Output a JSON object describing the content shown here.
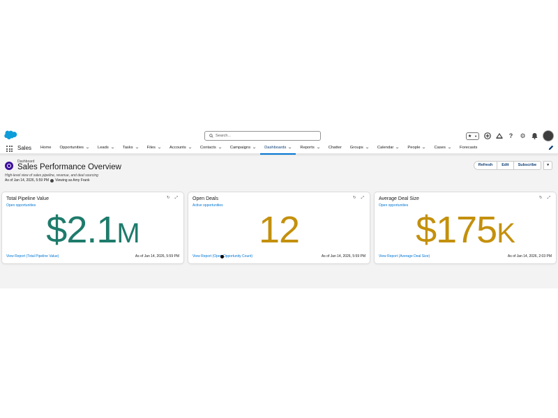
{
  "header": {
    "search_placeholder": "Search..."
  },
  "nav": {
    "app_name": "Sales",
    "items": [
      {
        "label": "Home",
        "chevron": false
      },
      {
        "label": "Opportunities",
        "chevron": true
      },
      {
        "label": "Leads",
        "chevron": true
      },
      {
        "label": "Tasks",
        "chevron": true
      },
      {
        "label": "Files",
        "chevron": true
      },
      {
        "label": "Accounts",
        "chevron": true
      },
      {
        "label": "Contacts",
        "chevron": true
      },
      {
        "label": "Campaigns",
        "chevron": true
      },
      {
        "label": "Dashboards",
        "chevron": true,
        "active": true
      },
      {
        "label": "Reports",
        "chevron": true
      },
      {
        "label": "Chatter",
        "chevron": false
      },
      {
        "label": "Groups",
        "chevron": true
      },
      {
        "label": "Calendar",
        "chevron": true
      },
      {
        "label": "People",
        "chevron": true
      },
      {
        "label": "Cases",
        "chevron": true
      },
      {
        "label": "Forecasts",
        "chevron": false
      }
    ]
  },
  "page": {
    "label": "Dashboard",
    "title": "Sales Performance Overview",
    "description": "High-level view of sales pipeline, revenue, and deal sourcing",
    "as_of": "As of Jan 14, 2026, 5:59 PM",
    "viewing_as": "Viewing as Amy Frank",
    "buttons": {
      "refresh": "Refresh",
      "edit": "Edit",
      "subscribe": "Subscribe",
      "more": "▾"
    }
  },
  "cards": [
    {
      "title": "Total Pipeline Value",
      "subtitle": "Open opportunities",
      "value": "$2.1",
      "suffix": "M",
      "color": "#1e7b6b",
      "link": "View Report (Total Pipeline Value)",
      "timestamp": "As of Jan 14, 2026, 5:59 PM"
    },
    {
      "title": "Open Deals",
      "subtitle": "Active opportunities",
      "value": "12",
      "suffix": "",
      "color": "#c4900c",
      "link": "View Report (Open Opportunity Count)",
      "timestamp": "As of Jan 14, 2026, 5:59 PM"
    },
    {
      "title": "Average Deal Size",
      "subtitle": "Open opportunities",
      "value": "$175",
      "suffix": "K",
      "color": "#c4900c",
      "link": "View Report (Average Deal Size)",
      "timestamp": "As of Jan 14, 2026, 2:03 PM"
    }
  ],
  "icons": {
    "refresh": "↻",
    "expand": "⤢"
  }
}
